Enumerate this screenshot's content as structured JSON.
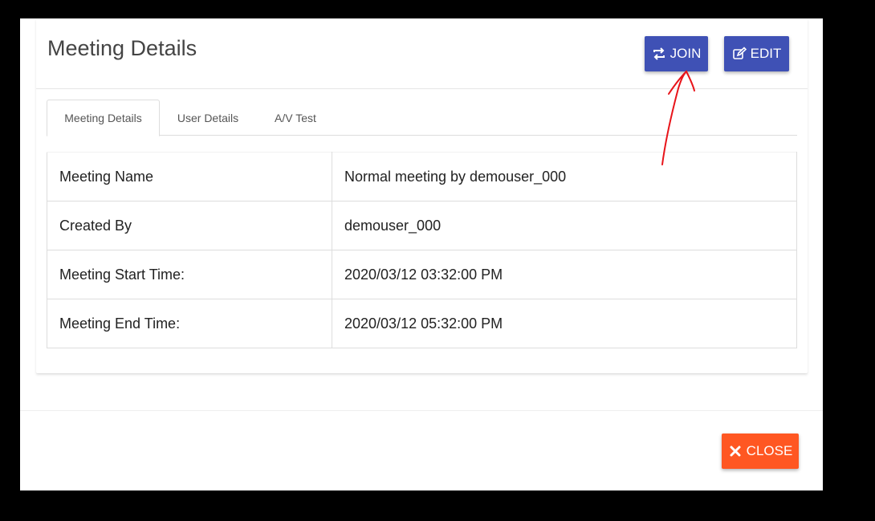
{
  "modal": {
    "title": "Meeting Details",
    "join_label": "JOIN",
    "edit_label": "EDIT",
    "close_label": "CLOSE"
  },
  "tabs": [
    {
      "label": "Meeting Details",
      "active": true
    },
    {
      "label": "User Details",
      "active": false
    },
    {
      "label": "A/V Test",
      "active": false
    }
  ],
  "details": [
    {
      "label": "Meeting Name",
      "value": "Normal meeting by demouser_000"
    },
    {
      "label": "Created By",
      "value": "demouser_000"
    },
    {
      "label": "Meeting Start Time:",
      "value": "2020/03/12 03:32:00 PM"
    },
    {
      "label": "Meeting End Time:",
      "value": "2020/03/12 05:32:00 PM"
    }
  ],
  "icons": {
    "join": "refresh-icon",
    "edit": "edit-icon",
    "close": "close-icon"
  },
  "colors": {
    "primary": "#3f51b5",
    "danger": "#ff5722",
    "annotation": "#e8141a"
  }
}
